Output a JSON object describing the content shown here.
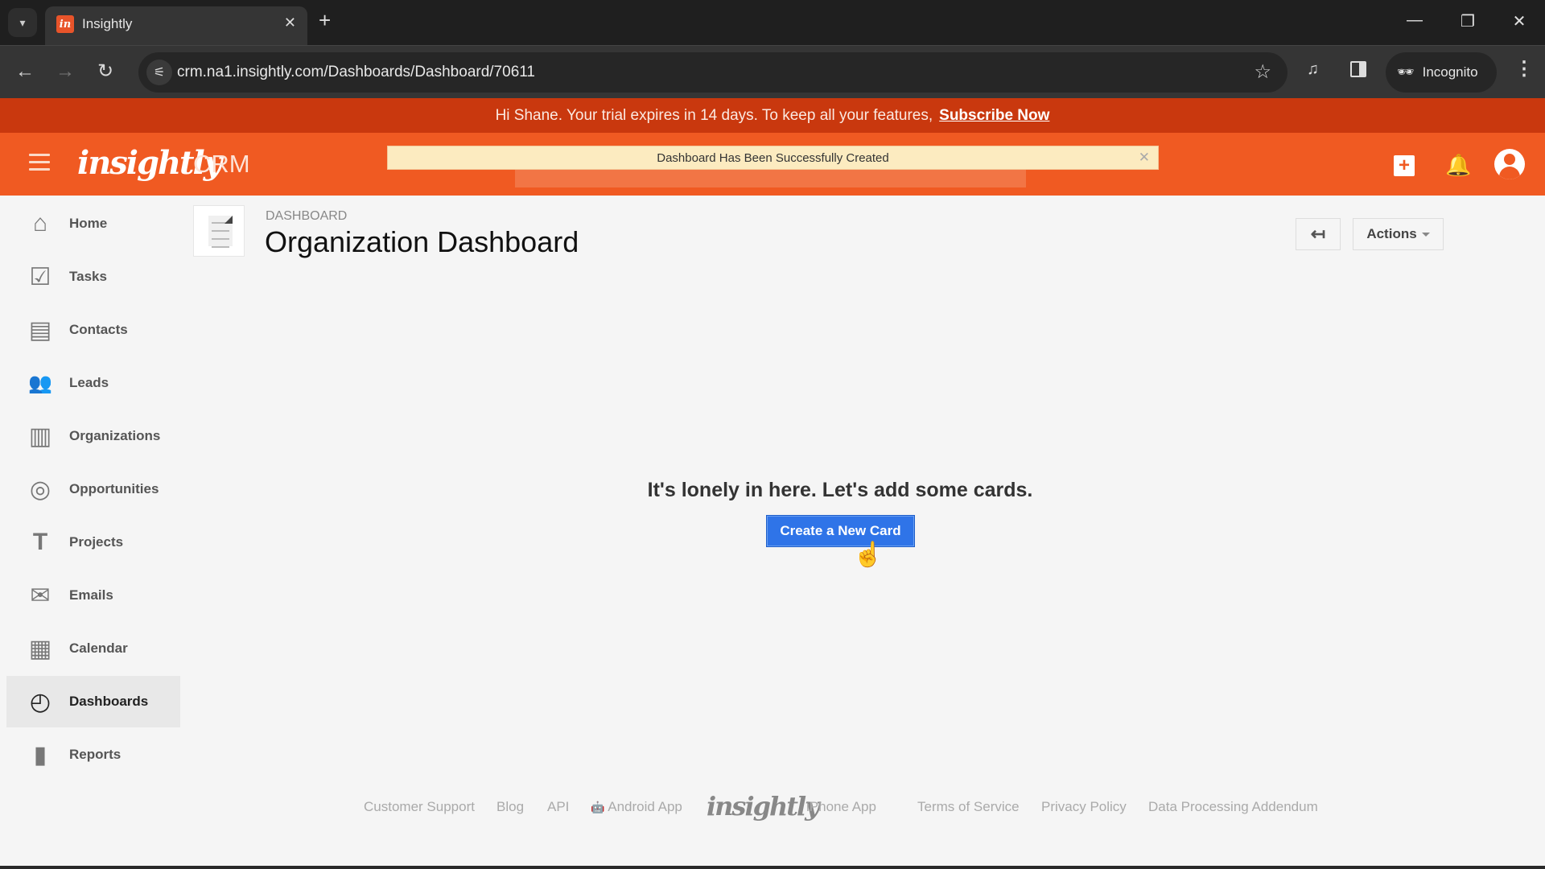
{
  "browser": {
    "tab_title": "Insightly",
    "favicon_letter": "in",
    "url": "crm.na1.insightly.com/Dashboards/Dashboard/70611",
    "incognito_label": "Incognito",
    "icons": {
      "tab_list": "▾",
      "tab_close": "✕",
      "new_tab": "+",
      "minimize": "—",
      "restore": "❐",
      "close": "✕",
      "back": "←",
      "forward": "→",
      "reload": "↻",
      "site_info": "⚟",
      "star": "☆",
      "media": "♫",
      "incognito": "🕶",
      "menu": "⋮"
    }
  },
  "trial_banner": {
    "message": "Hi Shane. Your trial expires in 14 days. To keep all your features,",
    "link": "Subscribe Now"
  },
  "header": {
    "logo": "insightly",
    "product": "CRM",
    "toast": "Dashboard Has Been Successfully Created",
    "toast_close": "✕",
    "add_icon": "+",
    "bell_icon": "🔔"
  },
  "sidebar": {
    "items": [
      {
        "label": "Home",
        "icon": "⌂",
        "active": false
      },
      {
        "label": "Tasks",
        "icon": "☑",
        "active": false
      },
      {
        "label": "Contacts",
        "icon": "▤",
        "active": false
      },
      {
        "label": "Leads",
        "icon": "👥",
        "active": false
      },
      {
        "label": "Organizations",
        "icon": "▥",
        "active": false
      },
      {
        "label": "Opportunities",
        "icon": "◎",
        "active": false
      },
      {
        "label": "Projects",
        "icon": "T",
        "active": false
      },
      {
        "label": "Emails",
        "icon": "✉",
        "active": false
      },
      {
        "label": "Calendar",
        "icon": "▦",
        "active": false
      },
      {
        "label": "Dashboards",
        "icon": "◴",
        "active": true
      },
      {
        "label": "Reports",
        "icon": "▮",
        "active": false
      }
    ]
  },
  "page": {
    "breadcrumb": "DASHBOARD",
    "title": "Organization Dashboard",
    "back_icon": "↤",
    "actions_label": "Actions",
    "empty_message": "It's lonely in here. Let's add some cards.",
    "create_card_label": "Create a New Card",
    "cursor_icon": "☝"
  },
  "footer": {
    "links": [
      "Customer Support",
      "Blog",
      "API",
      "Android App",
      "iPhone App",
      "Terms of Service",
      "Privacy Policy",
      "Data Processing Addendum"
    ],
    "logo": "insightly",
    "android_icon": "🤖",
    "apple_icon": ""
  }
}
